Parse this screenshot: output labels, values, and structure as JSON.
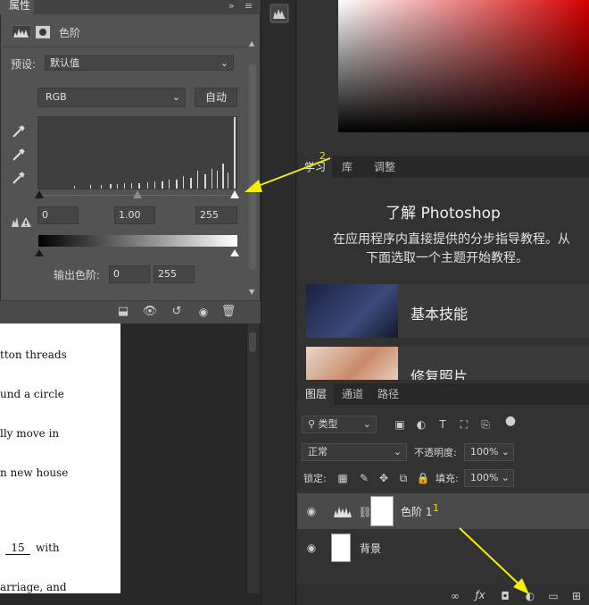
{
  "properties_panel": {
    "tab_label": "属性",
    "header_icons": [
      "levels-icon",
      "mask-icon"
    ],
    "adjustment_name": "色阶",
    "preset_label": "预设:",
    "preset_value": "默认值",
    "channel_value": "RGB",
    "auto_button": "自动",
    "eyedroppers": [
      "black-eyedropper-icon",
      "gray-eyedropper-icon",
      "white-eyedropper-icon"
    ],
    "input_black": "0",
    "input_gamma": "1.00",
    "input_white": "255",
    "output_label": "输出色阶:",
    "output_black": "0",
    "output_white": "255",
    "footer_icons": [
      "clip-to-layer-icon",
      "view-previous-icon",
      "reset-icon",
      "visibility-eye-icon",
      "trash-icon"
    ]
  },
  "document": {
    "lines": [
      "tton threads",
      "und a circle",
      "lly move in",
      "n new house",
      "15",
      "with",
      "arriage, and"
    ]
  },
  "learn_panel": {
    "tabs": [
      "学习",
      "库",
      "调整"
    ],
    "title": "了解 Photoshop",
    "description_line1": "在应用程序内直接提供的分步指导教程。从",
    "description_line2": "下面选取一个主题开始教程。",
    "cards": [
      {
        "label": "基本技能"
      },
      {
        "label": "修复照片"
      }
    ]
  },
  "layers_panel": {
    "tabs": [
      "图层",
      "通道",
      "路径"
    ],
    "filter_label": "类型",
    "blend_mode": "正常",
    "opacity_label": "不透明度:",
    "opacity_value": "100%",
    "lock_label": "锁定:",
    "fill_label": "填充:",
    "fill_value": "100%",
    "layers": [
      {
        "name": "色阶 1",
        "type": "adjustment"
      },
      {
        "name": "背景",
        "type": "image"
      }
    ],
    "footer_icons": [
      "link-icon",
      "fx-icon",
      "mask-icon",
      "adjustment-layer-icon",
      "folder-icon",
      "new-layer-icon"
    ]
  },
  "annotations": {
    "label_1": "1",
    "label_2": "2",
    "arrow_color": "#f5ef00"
  },
  "colors": {
    "panel_bg": "#535353",
    "dark_bg": "#323232",
    "color_field_hue": "#d40000"
  }
}
